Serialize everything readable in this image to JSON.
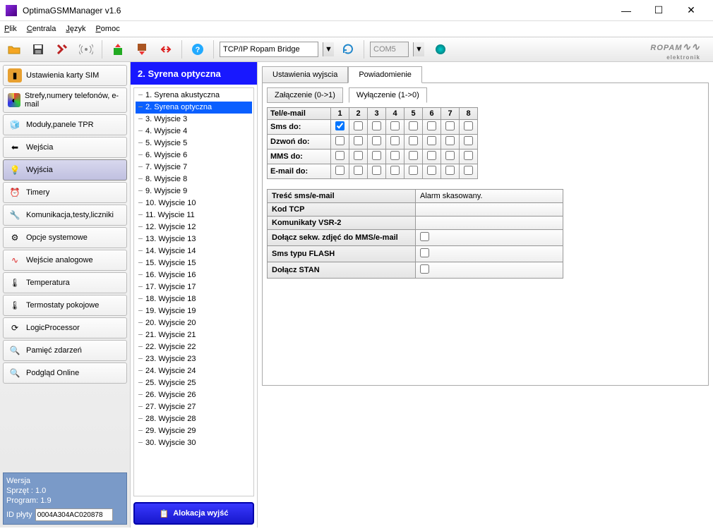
{
  "window": {
    "title": "OptimaGSMManager v1.6"
  },
  "menu": {
    "plik": "Plik",
    "centrala": "Centrala",
    "jezyk": "Język",
    "pomoc": "Pomoc"
  },
  "toolbar": {
    "conn_combo": "TCP/IP Ropam Bridge",
    "port_combo": "COM5"
  },
  "logo": {
    "brand": "ROPAM",
    "sub": "elektronik"
  },
  "sidebar": {
    "items": [
      {
        "label": "Ustawienia karty SIM"
      },
      {
        "label": "Strefy,numery telefonów, e-mail"
      },
      {
        "label": "Moduły,panele TPR"
      },
      {
        "label": "Wejścia"
      },
      {
        "label": "Wyjścia"
      },
      {
        "label": "Timery"
      },
      {
        "label": "Komunikacja,testy,liczniki"
      },
      {
        "label": "Opcje systemowe"
      },
      {
        "label": "Wejście analogowe"
      },
      {
        "label": "Temperatura"
      },
      {
        "label": "Termostaty pokojowe"
      },
      {
        "label": "LogicProcessor"
      },
      {
        "label": "Pamięć zdarzeń"
      },
      {
        "label": "Podgląd Online"
      }
    ],
    "version": {
      "title": "Wersja",
      "hw": "Sprzęt : 1.0",
      "sw": "Program: 1.9",
      "id_label": "ID płyty",
      "id_value": "0004A304AC020878"
    }
  },
  "outputs": {
    "header": "2. Syrena optyczna",
    "items": [
      "1. Syrena akustyczna",
      "2. Syrena optyczna",
      "3. Wyjscie 3",
      "4. Wyjscie 4",
      "5. Wyjscie 5",
      "6. Wyjscie 6",
      "7. Wyjscie 7",
      "8. Wyjscie 8",
      "9. Wyjscie 9",
      "10. Wyjscie 10",
      "11. Wyjscie 11",
      "12. Wyjscie 12",
      "13. Wyjscie 13",
      "14. Wyjscie 14",
      "15. Wyjscie 15",
      "16. Wyjscie 16",
      "17. Wyjscie 17",
      "18. Wyjscie 18",
      "19. Wyjscie 19",
      "20. Wyjscie 20",
      "21. Wyjscie 21",
      "22. Wyjscie 22",
      "23. Wyjscie 23",
      "24. Wyjscie 24",
      "25. Wyjscie 25",
      "26. Wyjscie 26",
      "27. Wyjscie 27",
      "28. Wyjscie 28",
      "29. Wyjscie 29",
      "30. Wyjscie 30"
    ],
    "alloc_btn": "Alokacja wyjść"
  },
  "main": {
    "tab1": "Ustawienia wyjscia",
    "tab2": "Powiadomienie",
    "subtab1": "Załączenie (0->1)",
    "subtab2": "Wyłączenie (1->0)",
    "grid": {
      "cols": [
        "Tel/e-mail",
        "1",
        "2",
        "3",
        "4",
        "5",
        "6",
        "7",
        "8"
      ],
      "rows": [
        "Sms do:",
        "Dzwoń do:",
        "MMS do:",
        "E-mail do:"
      ],
      "checked": {
        "0_0": true
      }
    },
    "cfg": {
      "tresc_label": "Treść sms/e-mail",
      "tresc_value": "Alarm skasowany.",
      "kod_label": "Kod TCP",
      "vsr_label": "Komunikaty VSR-2",
      "mms_label": "Dołącz sekw. zdjęć do MMS/e-mail",
      "flash_label": "Sms typu FLASH",
      "stan_label": "Dołącz STAN"
    }
  }
}
